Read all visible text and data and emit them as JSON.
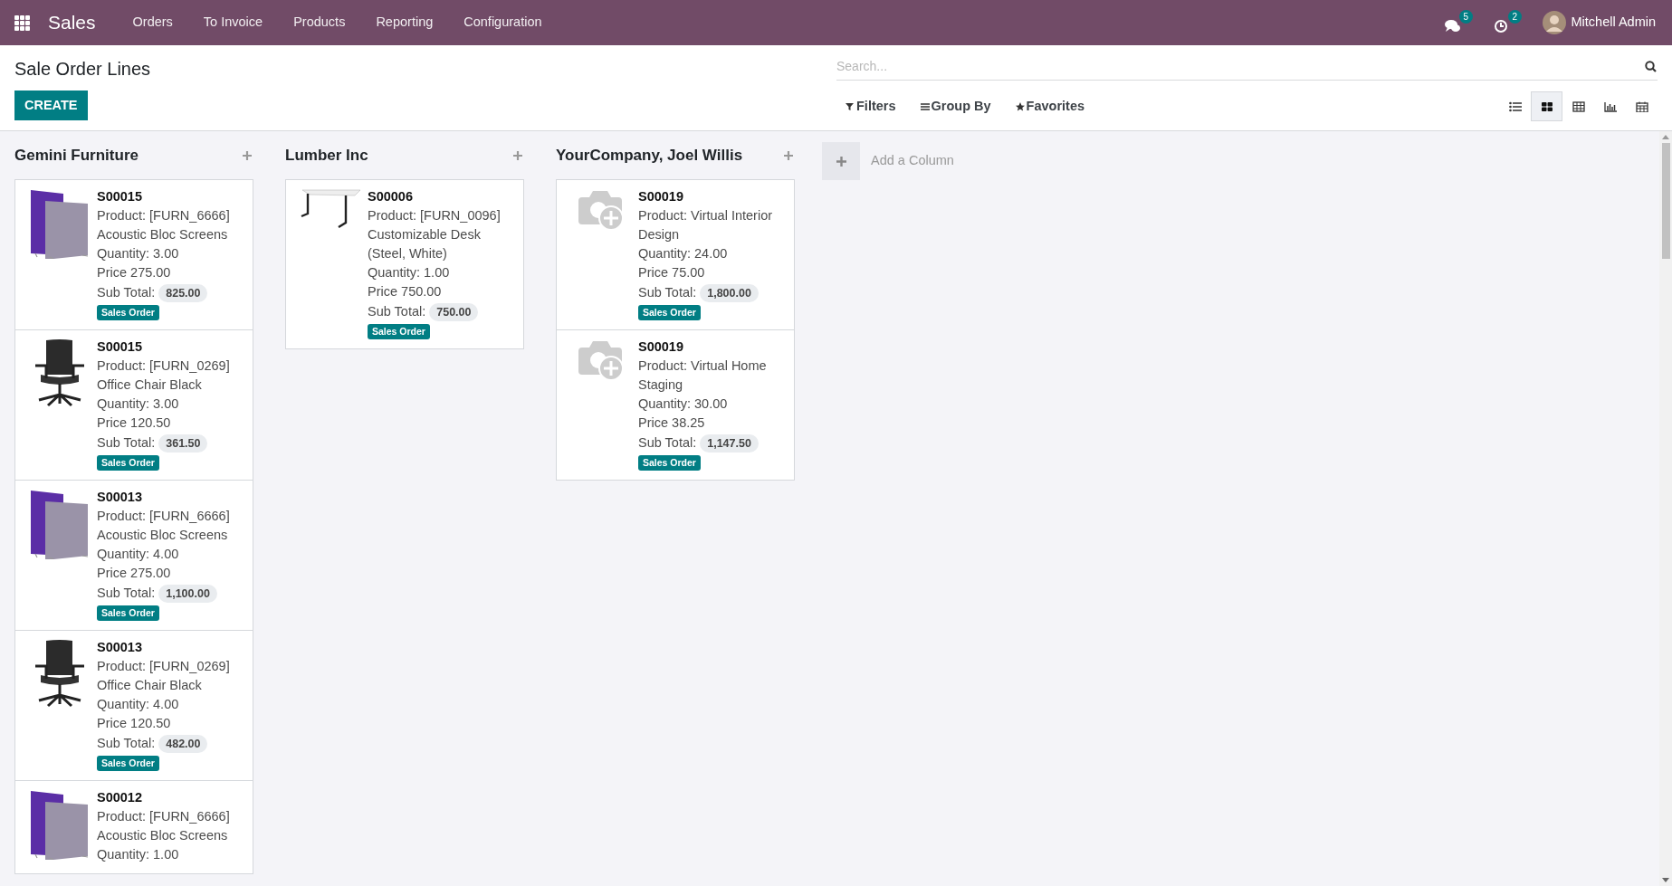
{
  "navbar": {
    "app": "Sales",
    "menu": [
      "Orders",
      "To Invoice",
      "Products",
      "Reporting",
      "Configuration"
    ],
    "messages_count": "5",
    "activities_count": "2",
    "user": "Mitchell Admin"
  },
  "control_panel": {
    "title": "Sale Order Lines",
    "create": "CREATE",
    "search": {
      "placeholder": "Search..."
    },
    "filters": [
      "Filters",
      "Group By",
      "Favorites"
    ],
    "views": [
      {
        "kind": "list",
        "selected": false
      },
      {
        "kind": "kanban",
        "selected": true
      },
      {
        "kind": "grid",
        "selected": false
      },
      {
        "kind": "graph",
        "selected": false
      },
      {
        "kind": "calendar",
        "selected": false
      }
    ]
  },
  "columns": [
    {
      "title": "Gemini Furniture",
      "cards": [
        {
          "ref": "S00015",
          "product": "Product: [FURN_6666] Acoustic Bloc Screens",
          "quantity": "Quantity: 3.00",
          "price": "Price 275.00",
          "subtotal_label": "Sub Total:",
          "subtotal": "825.00",
          "tag": "Sales Order",
          "kind": "screens"
        },
        {
          "ref": "S00015",
          "product": "Product: [FURN_0269] Office Chair Black",
          "quantity": "Quantity: 3.00",
          "price": "Price 120.50",
          "subtotal_label": "Sub Total:",
          "subtotal": "361.50",
          "tag": "Sales Order",
          "kind": "chair"
        },
        {
          "ref": "S00013",
          "product": "Product: [FURN_6666] Acoustic Bloc Screens",
          "quantity": "Quantity: 4.00",
          "price": "Price 275.00",
          "subtotal_label": "Sub Total:",
          "subtotal": "1,100.00",
          "tag": "Sales Order",
          "kind": "screens"
        },
        {
          "ref": "S00013",
          "product": "Product: [FURN_0269] Office Chair Black",
          "quantity": "Quantity: 4.00",
          "price": "Price 120.50",
          "subtotal_label": "Sub Total:",
          "subtotal": "482.00",
          "tag": "Sales Order",
          "kind": "chair"
        },
        {
          "ref": "S00012",
          "product": "Product: [FURN_6666] Acoustic Bloc Screens",
          "quantity": "Quantity: 1.00",
          "kind": "screens"
        }
      ]
    },
    {
      "title": "Lumber Inc",
      "cards": [
        {
          "ref": "S00006",
          "product": "Product: [FURN_0096] Customizable Desk (Steel, White)",
          "quantity": "Quantity: 1.00",
          "price": "Price 750.00",
          "subtotal_label": "Sub Total:",
          "subtotal": "750.00",
          "tag": "Sales Order",
          "kind": "desk"
        }
      ]
    },
    {
      "title": "YourCompany, Joel Willis",
      "cards": [
        {
          "ref": "S00019",
          "product": "Product: Virtual Interior Design",
          "quantity": "Quantity: 24.00",
          "price": "Price 75.00",
          "subtotal_label": "Sub Total:",
          "subtotal": "1,800.00",
          "tag": "Sales Order",
          "kind": "placeholder"
        },
        {
          "ref": "S00019",
          "product": "Product: Virtual Home Staging",
          "quantity": "Quantity: 30.00",
          "price": "Price 38.25",
          "subtotal_label": "Sub Total:",
          "subtotal": "1,147.50",
          "tag": "Sales Order",
          "kind": "placeholder"
        }
      ]
    }
  ],
  "add_column": "Add a Column"
}
